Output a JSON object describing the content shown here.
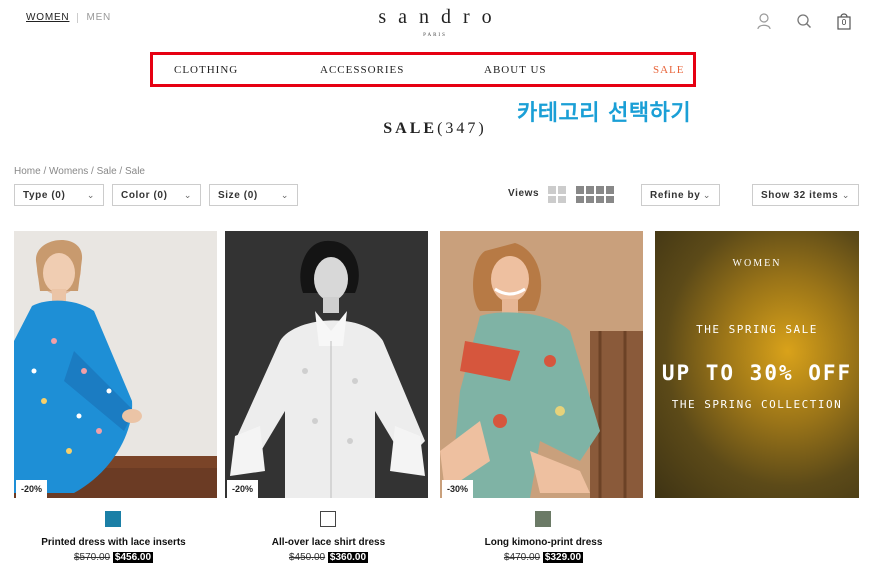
{
  "header": {
    "gender_active": "WOMEN",
    "gender_inactive": "MEN",
    "logo_name": "sandro",
    "logo_sub": "PARIS",
    "icons": [
      "account-icon",
      "search-icon",
      "bag-icon"
    ],
    "bag_count": "0"
  },
  "nav": {
    "clothing": "CLOTHING",
    "accessories": "ACCESSORIES",
    "about": "ABOUT US",
    "sale": "SALE",
    "highlight_color": "#e60012"
  },
  "annotation": "카테고리 선택하기",
  "title": {
    "label": "SALE",
    "count": "(347)"
  },
  "breadcrumb": "Home / Womens / Sale / Sale",
  "filters": {
    "type": "Type (0)",
    "color": "Color (0)",
    "size": "Size (0)",
    "views": "Views",
    "refine": "Refine by",
    "show": "Show 32 items"
  },
  "products": [
    {
      "name": "Printed dress with lace inserts",
      "old_price": "$570.00",
      "new_price": "$456.00",
      "discount": "-20%",
      "swatch": "#1b7fa6"
    },
    {
      "name": "All-over lace shirt dress",
      "old_price": "$450.00",
      "new_price": "$360.00",
      "discount": "-20%",
      "swatch": "#ffffff"
    },
    {
      "name": "Long kimono-print dress",
      "old_price": "$470.00",
      "new_price": "$329.00",
      "discount": "-30%",
      "swatch": "#6b7a66"
    }
  ],
  "banner": {
    "women": "WOMEN",
    "line1": "THE SPRING SALE",
    "line2": "UP TO 30% OFF",
    "line3": "THE SPRING COLLECTION"
  }
}
